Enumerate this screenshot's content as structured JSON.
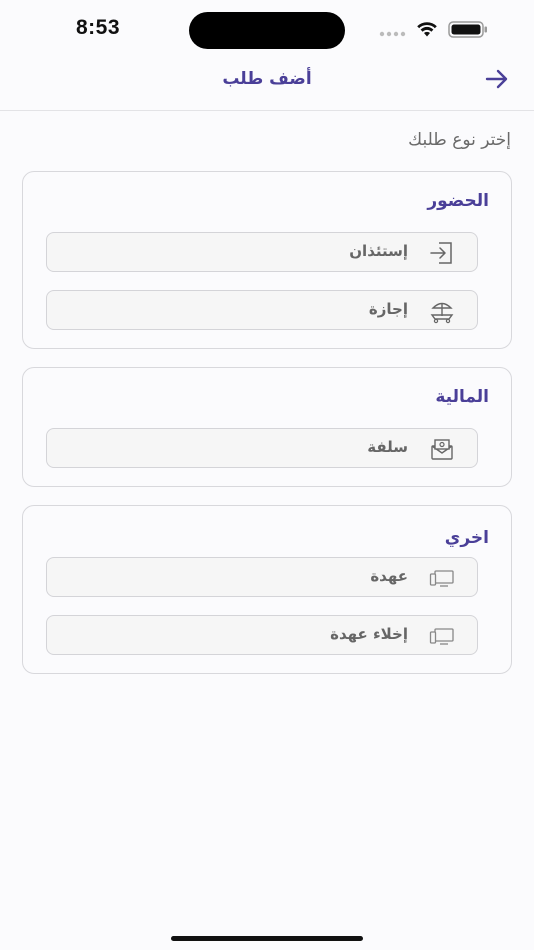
{
  "status_bar": {
    "time": "8:53"
  },
  "nav": {
    "title": "أضف طلب",
    "back_icon": "arrow-right-icon"
  },
  "prompt": "إختر نوع طلبك",
  "sections": [
    {
      "title": "الحضور",
      "items": [
        {
          "label": "إستئذان",
          "icon": "sign-in-icon"
        },
        {
          "label": "إجازة",
          "icon": "beach-umbrella-icon"
        }
      ]
    },
    {
      "title": "المالية",
      "items": [
        {
          "label": "سلفة",
          "icon": "money-envelope-icon"
        }
      ]
    },
    {
      "title": "اخري",
      "items": [
        {
          "label": "عهدة",
          "icon": "devices-icon"
        },
        {
          "label": "إخلاء عهدة",
          "icon": "devices-icon"
        }
      ]
    }
  ],
  "colors": {
    "accent": "#4a3f98",
    "background": "#fbfbfd",
    "item_bg": "#f6f6f6"
  }
}
